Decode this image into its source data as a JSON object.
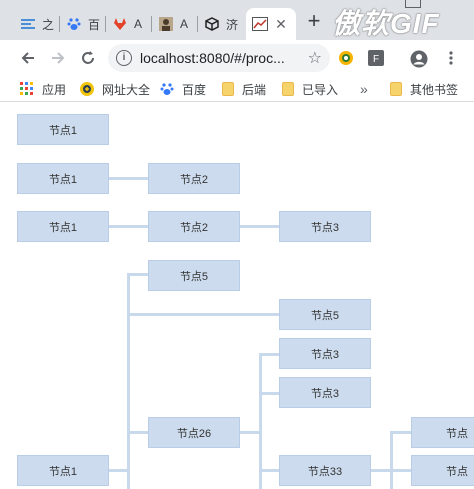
{
  "tabs": [
    {
      "label": "之",
      "icon": "list-icon"
    },
    {
      "label": "百",
      "icon": "baidu-paw-icon"
    },
    {
      "label": "A",
      "icon": "gitlab-icon"
    },
    {
      "label": "A",
      "icon": "avatar-icon"
    },
    {
      "label": "济",
      "icon": "box-icon"
    },
    {
      "label": "",
      "icon": "chart-icon",
      "active": true
    }
  ],
  "watermark": "傲软GIF",
  "address": {
    "url": "localhost:8080/#/proc..."
  },
  "bookmarks": [
    {
      "label": "应用",
      "icon": "apps-grid-icon"
    },
    {
      "label": "网址大全",
      "icon": "hao123-icon"
    },
    {
      "label": "百度",
      "icon": "baidu-paw-icon"
    },
    {
      "label": "后端",
      "icon": "folder-icon"
    },
    {
      "label": "已导入",
      "icon": "folder-icon"
    },
    {
      "label": "»",
      "icon": "more-icon"
    },
    {
      "label": "其他书签",
      "icon": "folder-icon"
    }
  ],
  "colors": {
    "node_fill": "#ccdcee",
    "line": "#c8d9ec"
  },
  "tree": {
    "row1": [
      "节点1"
    ],
    "row2": [
      "节点1",
      "节点2"
    ],
    "row3": [
      "节点1",
      "节点2",
      "节点3"
    ],
    "row4": {
      "root": "节点1",
      "child_a": "节点5",
      "child_b": "节点26",
      "leaf_a": "节点5",
      "leaf_b": "节点3",
      "leaf_c": "节点3",
      "leaf_d": "节点33",
      "cut_a": "节点",
      "cut_b": "节点"
    }
  }
}
